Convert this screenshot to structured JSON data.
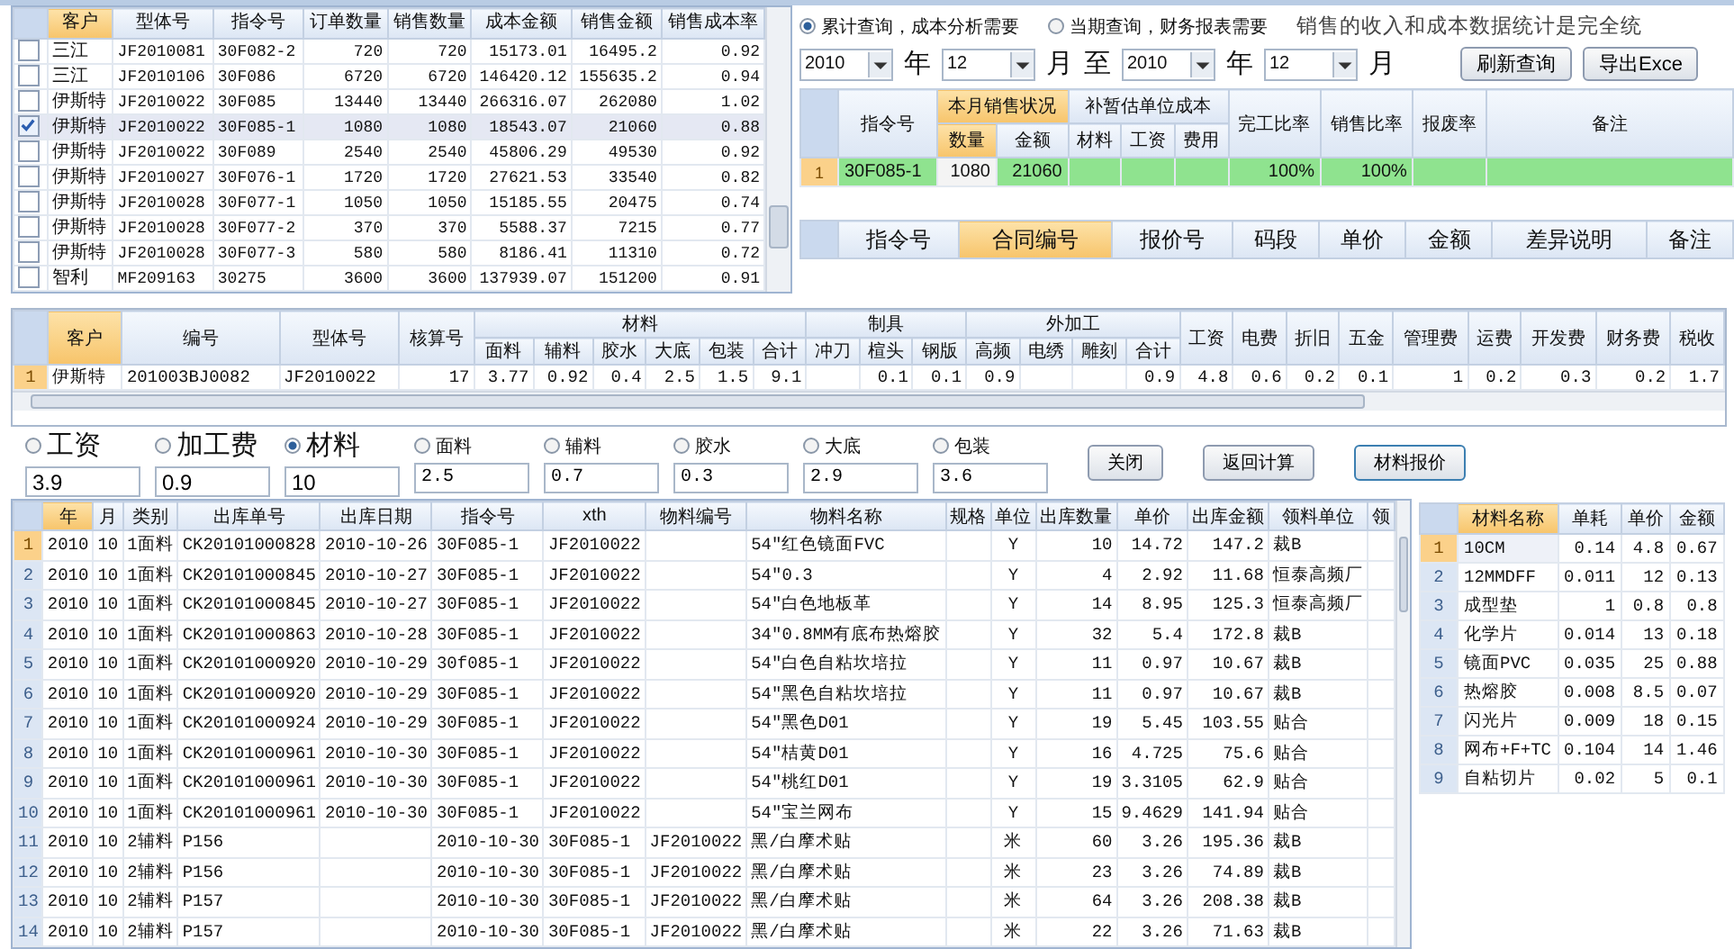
{
  "order_grid": {
    "columns": [
      {
        "label": "客户",
        "sorted": true
      },
      {
        "label": "型体号",
        "sorted": false
      },
      {
        "label": "指令号",
        "sorted": false
      },
      {
        "label": "订单数量",
        "sorted": false
      },
      {
        "label": "销售数量",
        "sorted": false
      },
      {
        "label": "成本金额",
        "sorted": false
      },
      {
        "label": "销售金额",
        "sorted": false
      },
      {
        "label": "销售成本率",
        "sorted": false
      }
    ],
    "rows": [
      {
        "checked": false,
        "selected": false,
        "cells": [
          "三江",
          "JF2010081",
          "30F082-2",
          "720",
          "720",
          "15173.01",
          "16495.2",
          "0.92"
        ]
      },
      {
        "checked": false,
        "selected": false,
        "cells": [
          "三江",
          "JF2010106",
          "30F086",
          "6720",
          "6720",
          "146420.12",
          "155635.2",
          "0.94"
        ]
      },
      {
        "checked": false,
        "selected": false,
        "cells": [
          "伊斯特",
          "JF2010022",
          "30F085",
          "13440",
          "13440",
          "266316.07",
          "262080",
          "1.02"
        ]
      },
      {
        "checked": true,
        "selected": true,
        "cells": [
          "伊斯特",
          "JF2010022",
          "30F085-1",
          "1080",
          "1080",
          "18543.07",
          "21060",
          "0.88"
        ]
      },
      {
        "checked": false,
        "selected": false,
        "cells": [
          "伊斯特",
          "JF2010022",
          "30F089",
          "2540",
          "2540",
          "45806.29",
          "49530",
          "0.92"
        ]
      },
      {
        "checked": false,
        "selected": false,
        "cells": [
          "伊斯特",
          "JF2010027",
          "30F076-1",
          "1720",
          "1720",
          "27621.53",
          "33540",
          "0.82"
        ]
      },
      {
        "checked": false,
        "selected": false,
        "cells": [
          "伊斯特",
          "JF2010028",
          "30F077-1",
          "1050",
          "1050",
          "15185.55",
          "20475",
          "0.74"
        ]
      },
      {
        "checked": false,
        "selected": false,
        "cells": [
          "伊斯特",
          "JF2010028",
          "30F077-2",
          "370",
          "370",
          "5588.37",
          "7215",
          "0.77"
        ]
      },
      {
        "checked": false,
        "selected": false,
        "cells": [
          "伊斯特",
          "JF2010028",
          "30F077-3",
          "580",
          "580",
          "8186.41",
          "11310",
          "0.72"
        ]
      },
      {
        "checked": false,
        "selected": false,
        "cells": [
          "智利",
          "MF209163",
          "30275",
          "3600",
          "3600",
          "137939.07",
          "151200",
          "0.91"
        ]
      }
    ]
  },
  "query": {
    "modes": [
      {
        "label": "累计查询，成本分析需要",
        "selected": true
      },
      {
        "label": "当期查询，财务报表需要",
        "selected": false
      }
    ],
    "note": "销售的收入和成本数据统计是完全统",
    "from_year": "2010",
    "from_month": "12",
    "to_year": "2010",
    "to_month": "12",
    "units": [
      "年",
      "月",
      "至",
      "年",
      "月"
    ],
    "buttons": [
      "刷新查询",
      "导出Exce"
    ]
  },
  "summary_grid": {
    "groups": [
      {
        "label": "指令号",
        "sorted": false
      },
      {
        "label": "本月销售状况",
        "sorted": true,
        "children": [
          {
            "label": "数量",
            "sorted": true
          },
          {
            "label": "金额",
            "sorted": false
          }
        ]
      },
      {
        "label": "补暂估单位成本",
        "sorted": false,
        "children": [
          {
            "label": "材料",
            "sorted": false
          },
          {
            "label": "工资",
            "sorted": false
          },
          {
            "label": "费用",
            "sorted": false
          }
        ]
      },
      {
        "label": "完工比率",
        "sorted": false
      },
      {
        "label": "销售比率",
        "sorted": false
      },
      {
        "label": "报废率",
        "sorted": false
      },
      {
        "label": "备注",
        "sorted": false
      }
    ],
    "rows": [
      {
        "no": "1",
        "selected": true,
        "cells": [
          "30F085-1",
          "1080",
          "21060",
          null,
          null,
          null,
          "100%",
          "100%",
          null,
          null
        ]
      }
    ]
  },
  "detail_grid": {
    "columns": [
      {
        "label": "指令号",
        "sorted": false
      },
      {
        "label": "合同编号",
        "sorted": true
      },
      {
        "label": "报价号",
        "sorted": false
      },
      {
        "label": "码段",
        "sorted": false
      },
      {
        "label": "单价",
        "sorted": false
      },
      {
        "label": "金额",
        "sorted": false
      },
      {
        "label": "差异说明",
        "sorted": false
      },
      {
        "label": "备注",
        "sorted": false
      }
    ]
  },
  "cost_grid": {
    "groups": [
      {
        "label": "客户",
        "sorted": true
      },
      {
        "label": "编号",
        "sorted": false
      },
      {
        "label": "型体号",
        "sorted": false
      },
      {
        "label": "核算号",
        "sorted": false
      },
      {
        "label": "材料",
        "sorted": false,
        "children": [
          {
            "label": "面料",
            "sorted": false
          },
          {
            "label": "辅料",
            "sorted": false
          },
          {
            "label": "胶水",
            "sorted": false
          },
          {
            "label": "大底",
            "sorted": false
          },
          {
            "label": "包装",
            "sorted": false
          },
          {
            "label": "合计",
            "sorted": false
          }
        ]
      },
      {
        "label": "制具",
        "sorted": false,
        "children": [
          {
            "label": "冲刀",
            "sorted": false
          },
          {
            "label": "楦头",
            "sorted": false
          },
          {
            "label": "钢版",
            "sorted": false
          }
        ]
      },
      {
        "label": "外加工",
        "sorted": false,
        "children": [
          {
            "label": "高频",
            "sorted": false
          },
          {
            "label": "电绣",
            "sorted": false
          },
          {
            "label": "雕刻",
            "sorted": false
          },
          {
            "label": "合计",
            "sorted": false
          }
        ]
      },
      {
        "label": "工资",
        "sorted": false
      },
      {
        "label": "电费",
        "sorted": false
      },
      {
        "label": "折旧",
        "sorted": false
      },
      {
        "label": "五金",
        "sorted": false
      },
      {
        "label": "管理费",
        "sorted": false
      },
      {
        "label": "运费",
        "sorted": false
      },
      {
        "label": "开发费",
        "sorted": false
      },
      {
        "label": "财务费",
        "sorted": false
      },
      {
        "label": "税收",
        "sorted": false
      }
    ],
    "rows": [
      {
        "no": "1",
        "selected": true,
        "cells": [
          "伊斯特",
          "201003BJ0082",
          "JF2010022",
          "17",
          "3.77",
          "0.92",
          "0.4",
          "2.5",
          "1.5",
          "9.1",
          null,
          "0.1",
          "0.1",
          "0.9",
          null,
          null,
          "0.9",
          "4.8",
          "0.6",
          "0.2",
          "0.1",
          "1",
          "0.2",
          "0.3",
          "0.2",
          "1.7"
        ]
      }
    ]
  },
  "rates": [
    {
      "label": "工资",
      "value": "3.9",
      "selected": false
    },
    {
      "label": "加工费",
      "value": "0.9",
      "selected": false
    },
    {
      "label": "材料",
      "value": "10",
      "selected": true
    }
  ],
  "material_rates": [
    {
      "label": "面料",
      "value": "2.5",
      "selected": false
    },
    {
      "label": "辅料",
      "value": "0.7",
      "selected": false
    },
    {
      "label": "胶水",
      "value": "0.3",
      "selected": false
    },
    {
      "label": "大底",
      "value": "2.9",
      "selected": false
    },
    {
      "label": "包装",
      "value": "3.6",
      "selected": false
    }
  ],
  "action_buttons": [
    "关闭",
    "返回计算",
    "材料报价"
  ],
  "issue_grid": {
    "columns": [
      {
        "label": "年",
        "sorted": true
      },
      {
        "label": "月",
        "sorted": false
      },
      {
        "label": "类别",
        "sorted": false
      },
      {
        "label": "出库单号",
        "sorted": false
      },
      {
        "label": "出库日期",
        "sorted": false
      },
      {
        "label": "指令号",
        "sorted": false
      },
      {
        "label": "xth",
        "sorted": false
      },
      {
        "label": "物料编号",
        "sorted": false
      },
      {
        "label": "物料名称",
        "sorted": false
      },
      {
        "label": "规格",
        "sorted": false
      },
      {
        "label": "单位",
        "sorted": false
      },
      {
        "label": "出库数量",
        "sorted": false
      },
      {
        "label": "单价",
        "sorted": false
      },
      {
        "label": "出库金额",
        "sorted": false
      },
      {
        "label": "领料单位",
        "sorted": false
      },
      {
        "label": "领",
        "sorted": false
      }
    ],
    "rows": [
      {
        "no": "1",
        "selected": true,
        "cells": [
          "2010",
          "10",
          "1面料",
          "CK20101000828",
          "2010-10-26",
          "30F085-1",
          "JF2010022",
          null,
          "54\"红色镜面FVC",
          null,
          "Y",
          "10",
          "14.72",
          "147.2",
          "裁B",
          null
        ]
      },
      {
        "no": "2",
        "selected": false,
        "cells": [
          "2010",
          "10",
          "1面料",
          "CK20101000845",
          "2010-10-27",
          "30F085-1",
          "JF2010022",
          null,
          "54\"0.3",
          null,
          "Y",
          "4",
          "2.92",
          "11.68",
          "恒泰高频厂",
          null
        ]
      },
      {
        "no": "3",
        "selected": false,
        "cells": [
          "2010",
          "10",
          "1面料",
          "CK20101000845",
          "2010-10-27",
          "30F085-1",
          "JF2010022",
          null,
          "54\"白色地板革",
          null,
          "Y",
          "14",
          "8.95",
          "125.3",
          "恒泰高频厂",
          null
        ]
      },
      {
        "no": "4",
        "selected": false,
        "cells": [
          "2010",
          "10",
          "1面料",
          "CK20101000863",
          "2010-10-28",
          "30F085-1",
          "JF2010022",
          null,
          "34\"0.8MM有底布热熔胶",
          null,
          "Y",
          "32",
          "5.4",
          "172.8",
          "裁B",
          null
        ]
      },
      {
        "no": "5",
        "selected": false,
        "cells": [
          "2010",
          "10",
          "1面料",
          "CK20101000920",
          "2010-10-29",
          "30f085-1",
          "JF2010022",
          null,
          "54\"白色自粘坎培拉",
          null,
          "Y",
          "11",
          "0.97",
          "10.67",
          "裁B",
          null
        ]
      },
      {
        "no": "6",
        "selected": false,
        "cells": [
          "2010",
          "10",
          "1面料",
          "CK20101000920",
          "2010-10-29",
          "30F085-1",
          "JF2010022",
          null,
          "54\"黑色自粘坎培拉",
          null,
          "Y",
          "11",
          "0.97",
          "10.67",
          "裁B",
          null
        ]
      },
      {
        "no": "7",
        "selected": false,
        "cells": [
          "2010",
          "10",
          "1面料",
          "CK20101000924",
          "2010-10-29",
          "30F085-1",
          "JF2010022",
          null,
          "54\"黑色D01",
          null,
          "Y",
          "19",
          "5.45",
          "103.55",
          "贴合",
          null
        ]
      },
      {
        "no": "8",
        "selected": false,
        "cells": [
          "2010",
          "10",
          "1面料",
          "CK20101000961",
          "2010-10-30",
          "30F085-1",
          "JF2010022",
          null,
          "54\"桔黄D01",
          null,
          "Y",
          "16",
          "4.725",
          "75.6",
          "贴合",
          null
        ]
      },
      {
        "no": "9",
        "selected": false,
        "cells": [
          "2010",
          "10",
          "1面料",
          "CK20101000961",
          "2010-10-30",
          "30F085-1",
          "JF2010022",
          null,
          "54\"桃红D01",
          null,
          "Y",
          "19",
          "3.3105",
          "62.9",
          "贴合",
          null
        ]
      },
      {
        "no": "10",
        "selected": false,
        "cells": [
          "2010",
          "10",
          "1面料",
          "CK20101000961",
          "2010-10-30",
          "30F085-1",
          "JF2010022",
          null,
          "54\"宝兰网布",
          null,
          "Y",
          "15",
          "9.4629",
          "141.94",
          "贴合",
          null
        ]
      },
      {
        "no": "11",
        "selected": false,
        "cells": [
          "2010",
          "10",
          "2辅料",
          "P156",
          null,
          "2010-10-30",
          "30F085-1",
          "JF2010022",
          "黑/白摩术贴",
          null,
          "米",
          "60",
          "3.26",
          "195.36",
          "裁B",
          null
        ]
      },
      {
        "no": "12",
        "selected": false,
        "cells": [
          "2010",
          "10",
          "2辅料",
          "P156",
          null,
          "2010-10-30",
          "30F085-1",
          "JF2010022",
          "黑/白摩术贴",
          null,
          "米",
          "23",
          "3.26",
          "74.89",
          "裁B",
          null
        ]
      },
      {
        "no": "13",
        "selected": false,
        "cells": [
          "2010",
          "10",
          "2辅料",
          "P157",
          null,
          "2010-10-30",
          "30F085-1",
          "JF2010022",
          "黑/白摩术贴",
          null,
          "米",
          "64",
          "3.26",
          "208.38",
          "裁B",
          null
        ]
      },
      {
        "no": "14",
        "selected": false,
        "cells": [
          "2010",
          "10",
          "2辅料",
          "P157",
          null,
          "2010-10-30",
          "30F085-1",
          "JF2010022",
          "黑/白摩术贴",
          null,
          "米",
          "22",
          "3.26",
          "71.63",
          "裁B",
          null
        ]
      }
    ]
  },
  "material_grid": {
    "columns": [
      {
        "label": "材料名称",
        "sorted": true
      },
      {
        "label": "单耗",
        "sorted": false
      },
      {
        "label": "单价",
        "sorted": false
      },
      {
        "label": "金额",
        "sorted": false
      }
    ],
    "rows": [
      {
        "no": "1",
        "selected": true,
        "cells": [
          "10CM",
          "0.14",
          "4.8",
          "0.67"
        ]
      },
      {
        "no": "2",
        "selected": false,
        "cells": [
          "12MMDFF",
          "0.011",
          "12",
          "0.13"
        ]
      },
      {
        "no": "3",
        "selected": false,
        "cells": [
          "成型垫",
          "1",
          "0.8",
          "0.8"
        ]
      },
      {
        "no": "4",
        "selected": false,
        "cells": [
          "化学片",
          "0.014",
          "13",
          "0.18"
        ]
      },
      {
        "no": "5",
        "selected": false,
        "cells": [
          "镜面PVC",
          "0.035",
          "25",
          "0.88"
        ]
      },
      {
        "no": "6",
        "selected": false,
        "cells": [
          "热熔胶",
          "0.008",
          "8.5",
          "0.07"
        ]
      },
      {
        "no": "7",
        "selected": false,
        "cells": [
          "闪光片",
          "0.009",
          "18",
          "0.15"
        ]
      },
      {
        "no": "8",
        "selected": false,
        "cells": [
          "网布+F+TC",
          "0.104",
          "14",
          "1.46"
        ]
      },
      {
        "no": "9",
        "selected": false,
        "cells": [
          "自粘切片",
          "0.02",
          "5",
          "0.1"
        ]
      }
    ]
  }
}
